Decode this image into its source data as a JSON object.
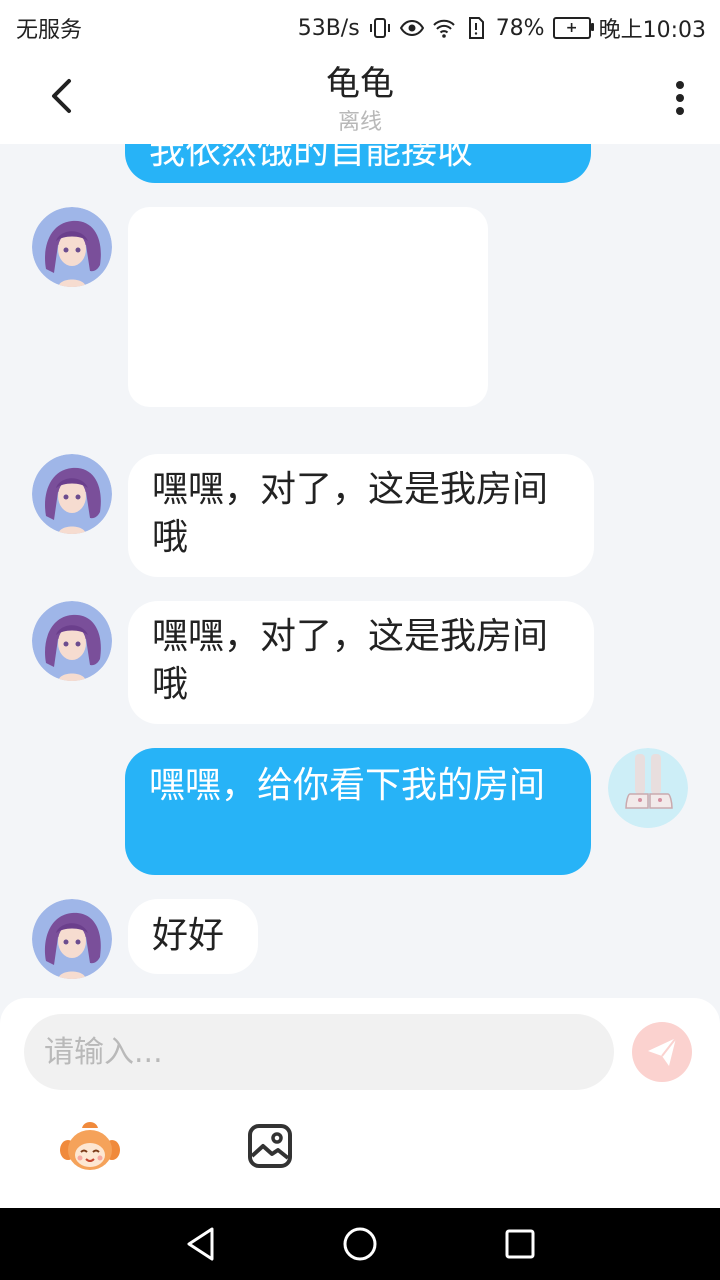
{
  "status_bar": {
    "carrier": "无服务",
    "speed": "53B/s",
    "battery_percent": "78%",
    "time": "晚上10:03"
  },
  "header": {
    "title": "龟龟",
    "subtitle": "离线"
  },
  "messages": {
    "partial_top": "我依然饿的自能接收",
    "m1": "",
    "m2": "嘿嘿，对了，这是我房间哦",
    "m3": "嘿嘿，对了，这是我房间哦",
    "m4": "嘿嘿，给你看下我的房间",
    "m5": "好好"
  },
  "composer": {
    "placeholder": "请输入..."
  },
  "colors": {
    "accent_blue": "#27b3f7",
    "send_button": "#fbd2cf",
    "incoming_bubble": "#ffffff",
    "background": "#f3f5f8"
  },
  "icons": {
    "back": "chevron-left-icon",
    "more": "more-vertical-icon",
    "send": "paper-plane-icon",
    "mascot": "mascot-icon",
    "image": "image-icon",
    "nav_back": "triangle-back-icon",
    "nav_home": "circle-home-icon",
    "nav_recent": "square-recent-icon"
  }
}
